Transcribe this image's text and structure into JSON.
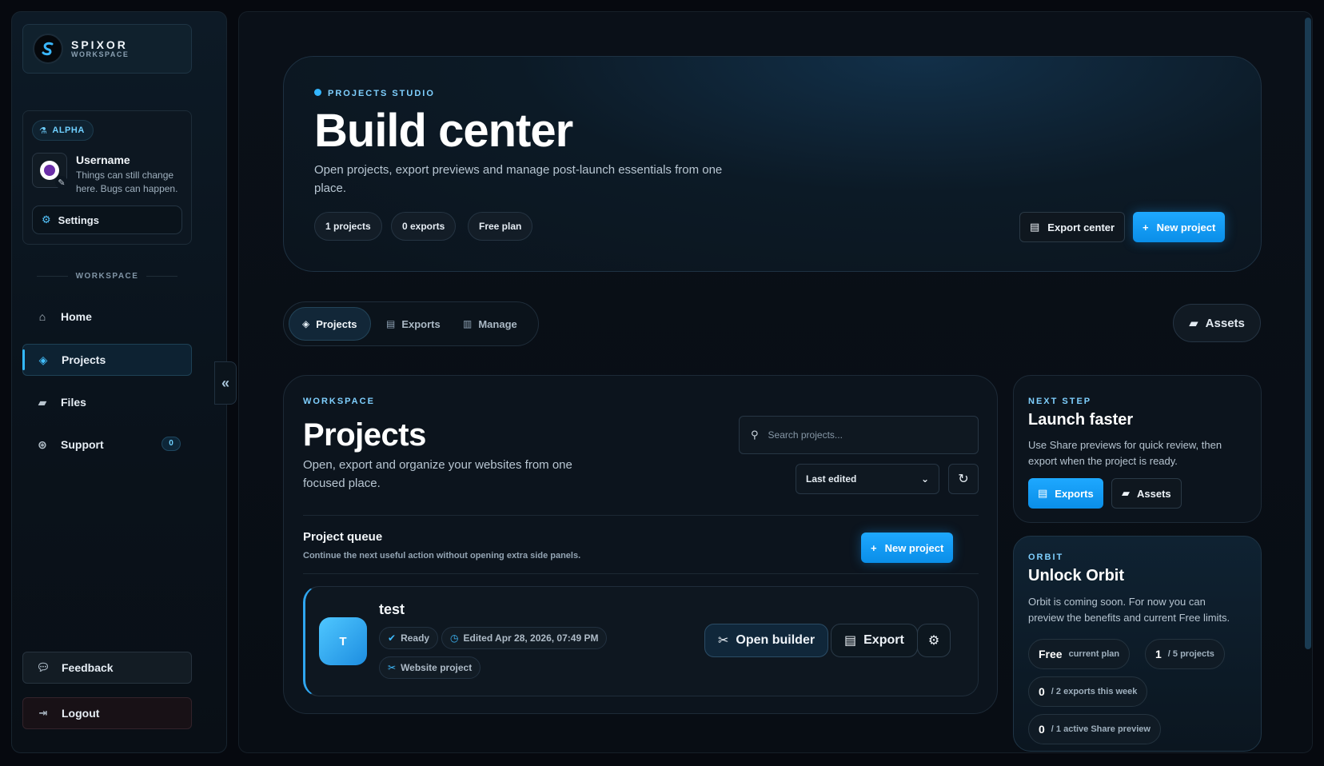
{
  "brand": {
    "name": "SPIXOR",
    "sub": "WORKSPACE"
  },
  "user": {
    "badge": "ALPHA",
    "name": "Username",
    "note": "Things can still change here. Bugs can happen.",
    "settings_label": "Settings"
  },
  "sidebar": {
    "section_label": "WORKSPACE",
    "items": [
      {
        "label": "Home",
        "icon": "home-icon"
      },
      {
        "label": "Projects",
        "icon": "layers-icon",
        "active": true
      },
      {
        "label": "Files",
        "icon": "folder-icon"
      },
      {
        "label": "Support",
        "icon": "lifebuoy-icon",
        "count": "0"
      }
    ],
    "feedback_label": "Feedback",
    "logout_label": "Logout"
  },
  "hero": {
    "eyebrow": "PROJECTS STUDIO",
    "title": "Build center",
    "description": "Open projects, export previews and manage post-launch essentials from one place.",
    "pills": [
      "1  projects",
      "0  exports",
      "Free  plan"
    ],
    "export_center_label": "Export center",
    "new_project_label": "New project"
  },
  "tabs": [
    {
      "label": "Projects",
      "active": true
    },
    {
      "label": "Exports"
    },
    {
      "label": "Manage"
    }
  ],
  "assets_label": "Assets",
  "projects": {
    "eyebrow": "WORKSPACE",
    "title": "Projects",
    "description": "Open, export and organize your websites from one focused place.",
    "search_placeholder": "Search projects...",
    "sort_selected": "Last edited",
    "queue_title": "Project queue",
    "queue_subtitle": "Continue the next useful action without opening extra side panels.",
    "new_project_label": "New project",
    "items": [
      {
        "initial": "T",
        "name": "test",
        "status": "Ready",
        "edited": "Edited Apr 28, 2026, 07:49 PM",
        "type": "Website project",
        "open_label": "Open builder",
        "export_label": "Export"
      }
    ]
  },
  "next_step": {
    "eyebrow": "NEXT STEP",
    "title": "Launch faster",
    "description": "Use Share previews for quick review, then export when the project is ready.",
    "exports_label": "Exports",
    "assets_label": "Assets"
  },
  "orbit": {
    "eyebrow": "ORBIT",
    "title": "Unlock Orbit",
    "description": "Orbit is coming soon. For now you can preview the benefits and current Free limits.",
    "stats": [
      {
        "value": "Free",
        "label": "current plan"
      },
      {
        "value": "1",
        "label": "/ 5 projects"
      },
      {
        "value": "0",
        "label": "/ 2 exports this week"
      },
      {
        "value": "0",
        "label": "/ 1 active Share preview"
      }
    ]
  },
  "colors": {
    "accent": "#1ea8ff",
    "background": "#06090f"
  }
}
